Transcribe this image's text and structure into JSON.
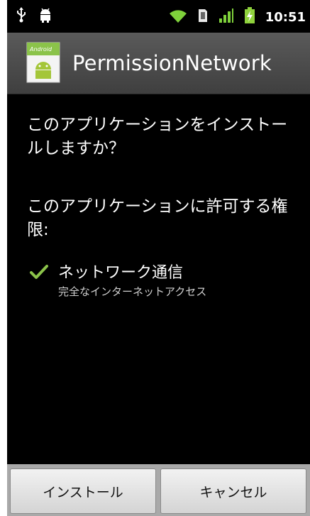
{
  "status_bar": {
    "time": "10:51",
    "icons_left": [
      "usb-icon",
      "android-debug-icon"
    ],
    "icons_right": [
      "wifi-icon",
      "sdcard-icon",
      "signal-icon",
      "battery-charging-icon"
    ]
  },
  "title_bar": {
    "app_name": "PermissionNetwork",
    "icon": "android-app-icon"
  },
  "install": {
    "question": "このアプリケーションをインストールしますか？",
    "permissions_heading": "このアプリケーションに許可する権限:",
    "permissions": [
      {
        "title": "ネットワーク通信",
        "description": "完全なインターネットアクセス",
        "icon": "check-icon"
      }
    ]
  },
  "buttons": {
    "install_label": "インストール",
    "cancel_label": "キャンセル"
  },
  "colors": {
    "accent_check": "#8bc34a",
    "wifi": "#7fd13b",
    "signal": "#7fd13b",
    "battery": "#8fd23c",
    "title_bar_bg": "#4c4c4c"
  }
}
